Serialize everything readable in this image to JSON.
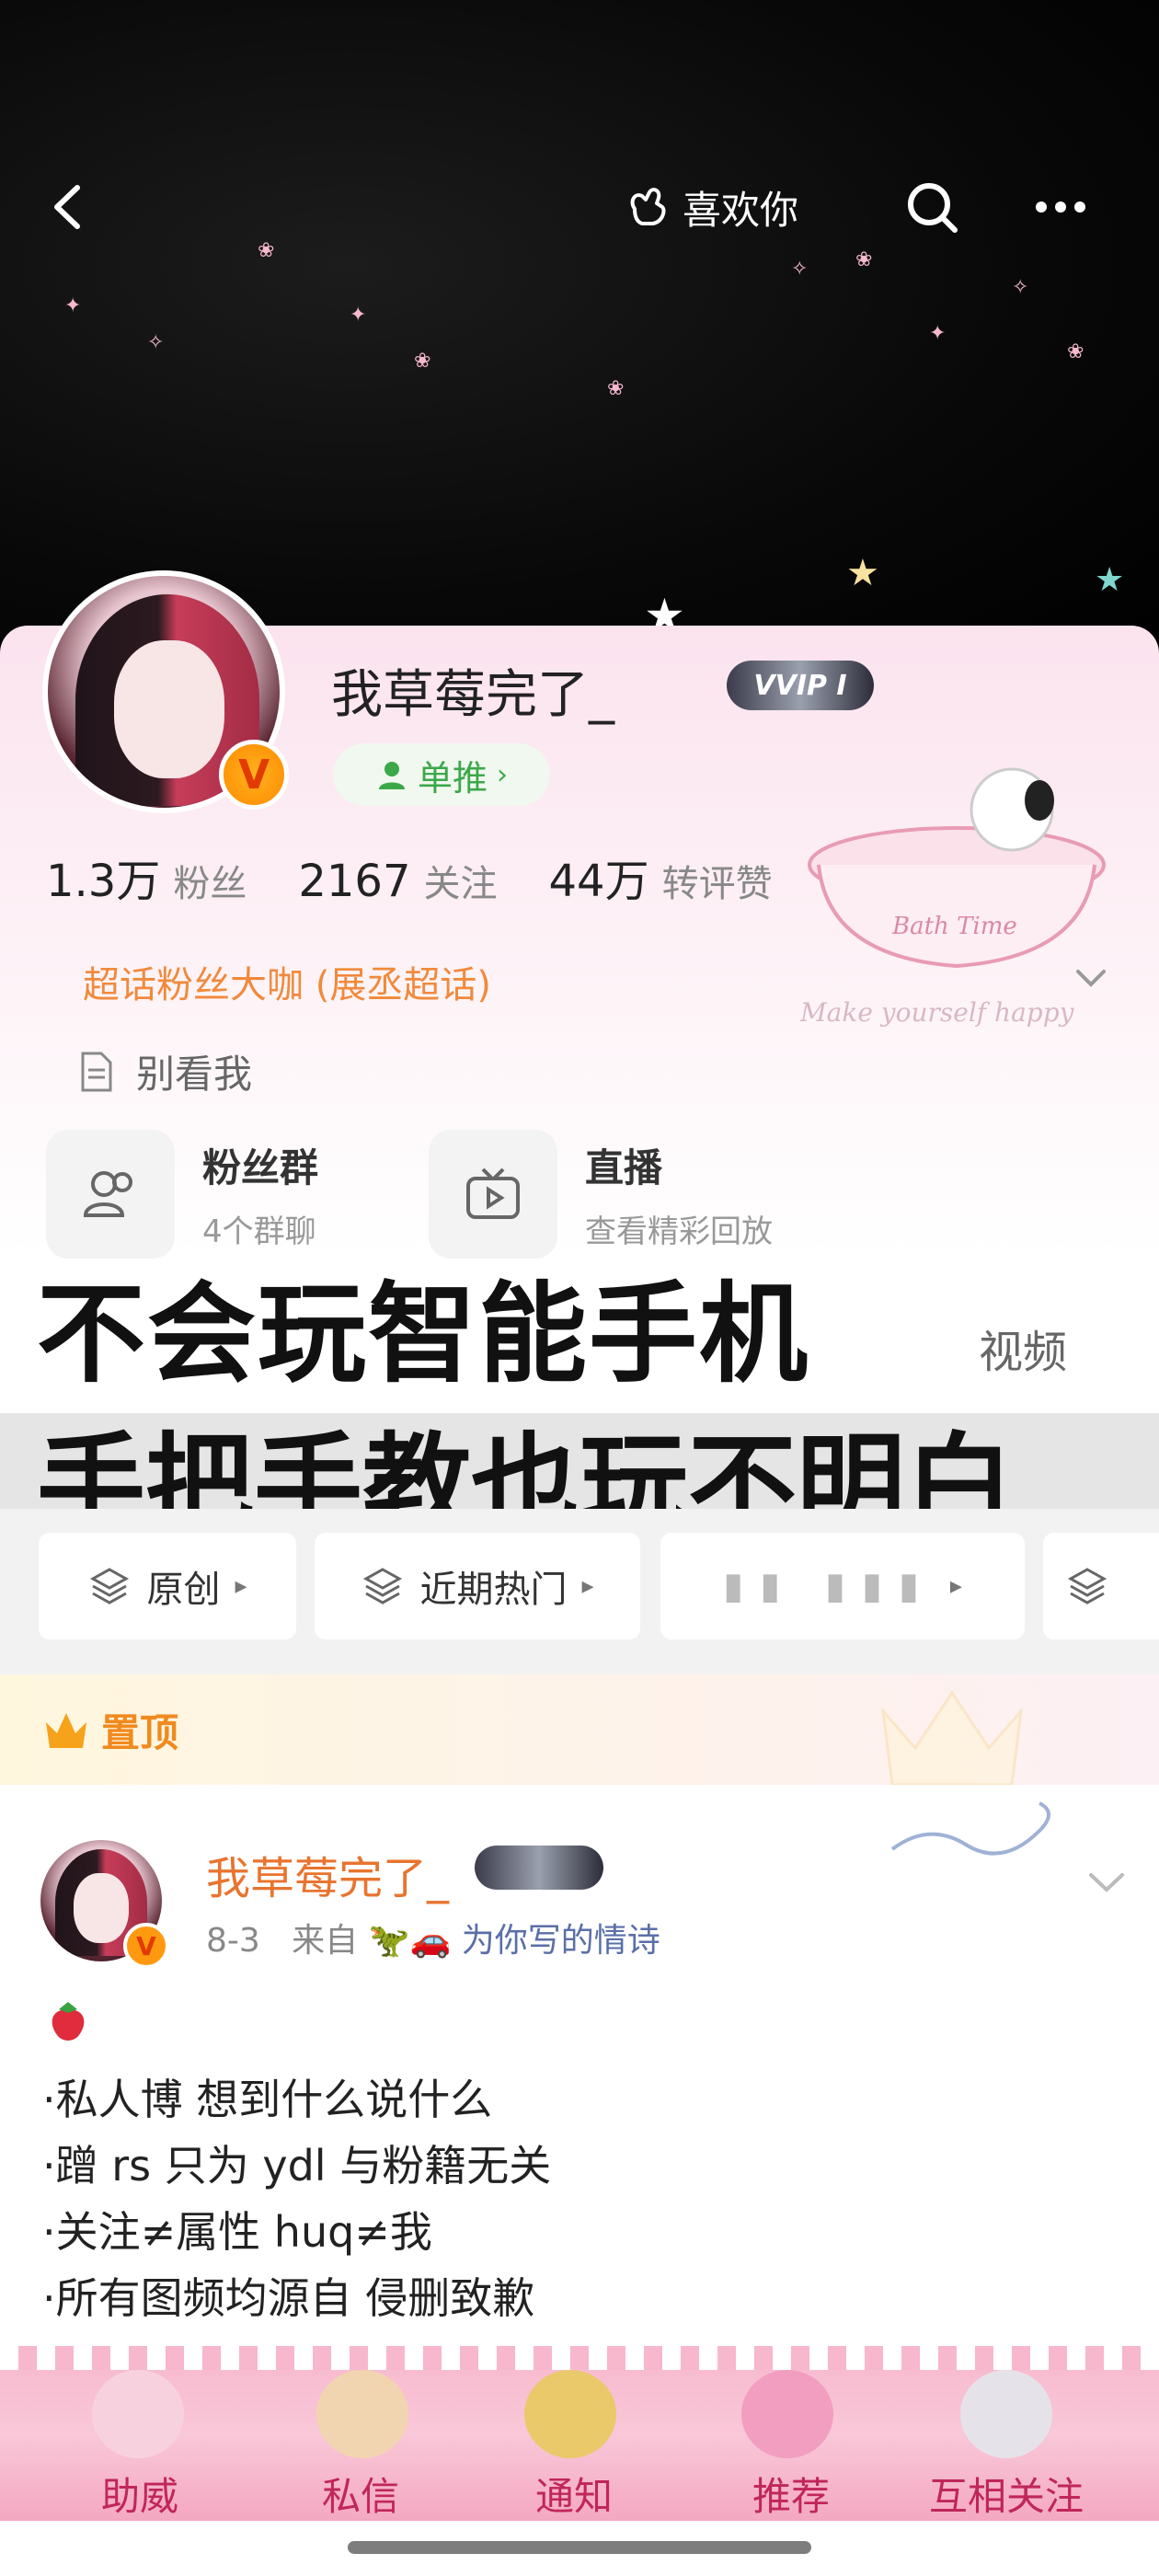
{
  "topnav": {
    "like_label": "喜欢你"
  },
  "profile": {
    "username": "我草莓完了_",
    "vip_badge": "VVIP I",
    "single_push": "单推",
    "stats": [
      {
        "value": "1.3万",
        "label": "粉丝"
      },
      {
        "value": "2167",
        "label": "关注"
      },
      {
        "value": "44万",
        "label": "转评赞"
      }
    ],
    "superfan": "超话粉丝大咖 (展丞超话)",
    "bio": "别看我",
    "bath_art_text_1": "Bath Time",
    "bath_art_text_2": "Make yourself happy"
  },
  "tiles": [
    {
      "title": "粉丝群",
      "sub": "4个群聊"
    },
    {
      "title": "直播",
      "sub": "查看精彩回放"
    }
  ],
  "caption": {
    "line1": "不会玩智能手机",
    "line2": "手把手教也玩不明白"
  },
  "video_tab": "视频",
  "chips": [
    {
      "label": "原创"
    },
    {
      "label": "近期热门"
    }
  ],
  "pinned": {
    "label": "置顶"
  },
  "post": {
    "name": "我草莓完了_",
    "date": "8-3",
    "from_prefix": "来自",
    "source": "为你写的情诗",
    "lines": [
      "·私人博 想到什么说什么",
      "·蹭 rs 只为 ydl 与粉籍无关",
      "·关注≠属性 huq≠我",
      "·所有图频均源自 侵删致歉"
    ]
  },
  "bottom_nav": [
    {
      "label": "助威"
    },
    {
      "label": "私信"
    },
    {
      "label": "通知"
    },
    {
      "label": "推荐"
    },
    {
      "label": "互相关注"
    }
  ],
  "colors": {
    "accent_orange": "#f08a3c",
    "push_green": "#3ca84a",
    "nav_pink": "#f7b7cd",
    "post_name": "#e8742f"
  },
  "icons": {
    "back": "chevron-left-icon",
    "like": "heart-hand-icon",
    "search": "search-icon",
    "more": "more-dots-icon",
    "bio": "document-icon",
    "fan_group": "people-icon",
    "live": "tv-icon",
    "chip": "layers-icon"
  }
}
